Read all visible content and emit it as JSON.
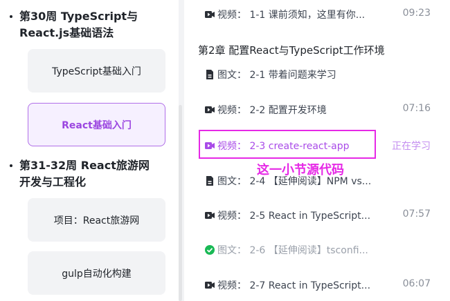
{
  "sidebar": {
    "sections": [
      {
        "title_line1": "第30周 TypeScript与",
        "title_line2": "React.js基础语法"
      },
      {
        "title_line1": "第31-32周 React旅游网",
        "title_line2": "开发与工程化"
      }
    ],
    "cards": [
      {
        "label": "TypeScript基础入门"
      },
      {
        "label": "React基础入门"
      },
      {
        "label": "项目：React旅游网"
      },
      {
        "label": "gulp自动化构建"
      }
    ]
  },
  "lessons": {
    "top_row": {
      "type": "视频：",
      "title": "1-1 课前须知，这里有你...",
      "time": "09:23"
    },
    "chapter_title": "第2章  配置React与TypeScript工作环境",
    "rows": [
      {
        "type": "图文：",
        "title": "2-1 带着问题来学习",
        "time": ""
      },
      {
        "type": "视频：",
        "title": "2-2 配置开发环境",
        "time": "07:16"
      },
      {
        "type": "视频：",
        "title": "2-3 create-react-app",
        "time": "正在学习"
      },
      {
        "type": "图文：",
        "title": "2-4 【延伸阅读】NPM vs...",
        "time": ""
      },
      {
        "type": "视频：",
        "title": "2-5 React in TypeScript...",
        "time": "07:57"
      },
      {
        "type": "图文：",
        "title": "2-6 【延伸阅读】tsconfi...",
        "time": ""
      },
      {
        "type": "视频：",
        "title": "2-7 React in TypeScript...",
        "time": "06:07"
      }
    ]
  },
  "annotation": {
    "text": "这一小节源代码"
  },
  "colors": {
    "accent": "#a94be8",
    "highlight": "#e628e6",
    "done": "#19b955"
  }
}
